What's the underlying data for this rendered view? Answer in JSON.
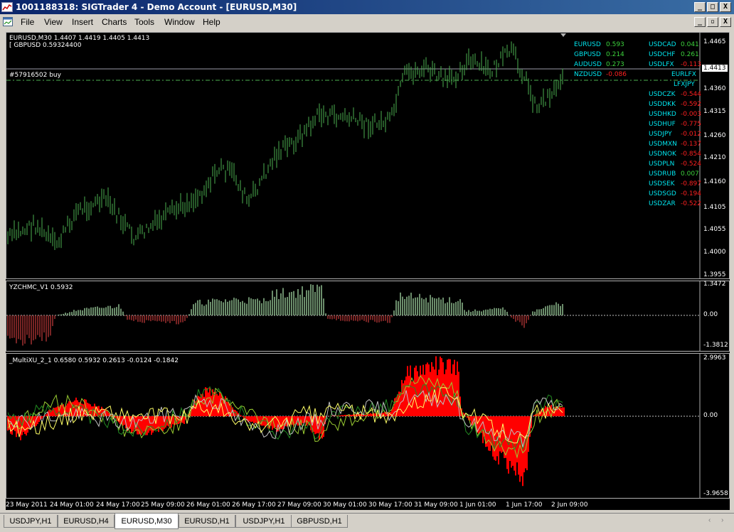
{
  "window": {
    "title": "1001188318: SIGTrader 4 - Demo Account - [EURUSD,M30]",
    "minimize": "_",
    "restore": "□",
    "close": "X"
  },
  "menu": [
    "File",
    "View",
    "Insert",
    "Charts",
    "Tools",
    "Window",
    "Help"
  ],
  "doc_controls": {
    "minimize": "_",
    "restore": "▫",
    "close": "X"
  },
  "main_chart": {
    "header": "EURUSD,M30  1.4407 1.4419 1.4405 1.4413",
    "sub_header": "[ GBPUSD 0.59324400",
    "order_label": "#57916502 buy",
    "current_price": "1.4413",
    "y_ticks": [
      "1.4465",
      "1.4360",
      "1.4315",
      "1.4260",
      "1.4210",
      "1.4160",
      "1.4105",
      "1.4055",
      "1.4000",
      "1.3955"
    ],
    "bar_color": "#4caf50",
    "order_line_color": "#4caf50",
    "price_line_color": "#9a9aa8"
  },
  "currency_pairs": {
    "left": [
      {
        "name": "EURUSD",
        "value": "0.593",
        "name_color": "#00e5ee",
        "value_color": "#3cd23c"
      },
      {
        "name": "GBPUSD",
        "value": "0.214",
        "name_color": "#00e5ee",
        "value_color": "#3cd23c"
      },
      {
        "name": "AUDUSD",
        "value": "0.273",
        "name_color": "#00e5ee",
        "value_color": "#3cd23c"
      },
      {
        "name": "NZDUSD",
        "value": "-0.086",
        "name_color": "#00e5ee",
        "value_color": "#ff2020"
      }
    ],
    "right": [
      {
        "name": "USDCAD",
        "value": "0.041",
        "name_color": "#00e5ee",
        "value_color": "#3cd23c"
      },
      {
        "name": "USDCHF",
        "value": "0.261",
        "name_color": "#00e5ee",
        "value_color": "#3cd23c"
      },
      {
        "name": "USDLFX",
        "value": "-0.113",
        "name_color": "#00e5ee",
        "value_color": "#ff2020"
      },
      {
        "name": "EURLFX",
        "value": "",
        "name_color": "#00e5ee",
        "value_color": "#3cd23c"
      },
      {
        "name": "LFXJPY",
        "value": "",
        "name_color": "#00e5ee",
        "value_color": "#3cd23c"
      },
      {
        "name": "USDCZK",
        "value": "-0.544",
        "name_color": "#00e5ee",
        "value_color": "#ff2020"
      },
      {
        "name": "USDDKK",
        "value": "-0.592",
        "name_color": "#00e5ee",
        "value_color": "#ff2020"
      },
      {
        "name": "USDHKD",
        "value": "-0.003",
        "name_color": "#00e5ee",
        "value_color": "#ff2020"
      },
      {
        "name": "USDHUF",
        "value": "-0.775",
        "name_color": "#00e5ee",
        "value_color": "#ff2020"
      },
      {
        "name": "USDJPY",
        "value": "-0.012",
        "name_color": "#00e5ee",
        "value_color": "#ff2020"
      },
      {
        "name": "USDMXN",
        "value": "-0.137",
        "name_color": "#00e5ee",
        "value_color": "#ff2020"
      },
      {
        "name": "USDNOK",
        "value": "-0.854",
        "name_color": "#00e5ee",
        "value_color": "#ff2020"
      },
      {
        "name": "USDPLN",
        "value": "-0.524",
        "name_color": "#00e5ee",
        "value_color": "#ff2020"
      },
      {
        "name": "USDRUB",
        "value": "0.007",
        "name_color": "#00e5ee",
        "value_color": "#3cd23c"
      },
      {
        "name": "USDSEK",
        "value": "-0.897",
        "name_color": "#00e5ee",
        "value_color": "#ff2020"
      },
      {
        "name": "USDSGD",
        "value": "-0.194",
        "name_color": "#00e5ee",
        "value_color": "#ff2020"
      },
      {
        "name": "USDZAR",
        "value": "-0.522",
        "name_color": "#00e5ee",
        "value_color": "#ff2020"
      }
    ]
  },
  "indicator1": {
    "header": "YZCHMC_V1 0.5932",
    "y_ticks": [
      "1.3472",
      "0.00",
      "-1.3812"
    ],
    "up_color": "#8fbc8f",
    "down_color": "#a03030"
  },
  "indicator2": {
    "header": "_MultiXU_2_1 0.6580 0.5932 0.2613 -0.0124 -0.1842",
    "y_ticks": [
      "2.9963",
      "0.00",
      "-3.9658"
    ],
    "fill_color": "#ff0000",
    "line_colors": [
      "#9acd32",
      "#228b22",
      "#c0c0c0",
      "#ffff66"
    ]
  },
  "time_axis": [
    "23 May 2011",
    "24 May 01:00",
    "24 May 17:00",
    "25 May 09:00",
    "26 May 01:00",
    "26 May 17:00",
    "27 May 09:00",
    "30 May 01:00",
    "30 May 17:00",
    "31 May 09:00",
    "1 Jun 01:00",
    "1 Jun 17:00",
    "2 Jun 09:00"
  ],
  "tabs": [
    {
      "label": "USDJPY,H1",
      "active": false
    },
    {
      "label": "EURUSD,H4",
      "active": false
    },
    {
      "label": "EURUSD,M30",
      "active": true
    },
    {
      "label": "EURUSD,H1",
      "active": false
    },
    {
      "label": "USDJPY,H1",
      "active": false
    },
    {
      "label": "GBPUSD,H1",
      "active": false
    }
  ],
  "tab_scroll": {
    "left": "‹",
    "right": "›"
  }
}
